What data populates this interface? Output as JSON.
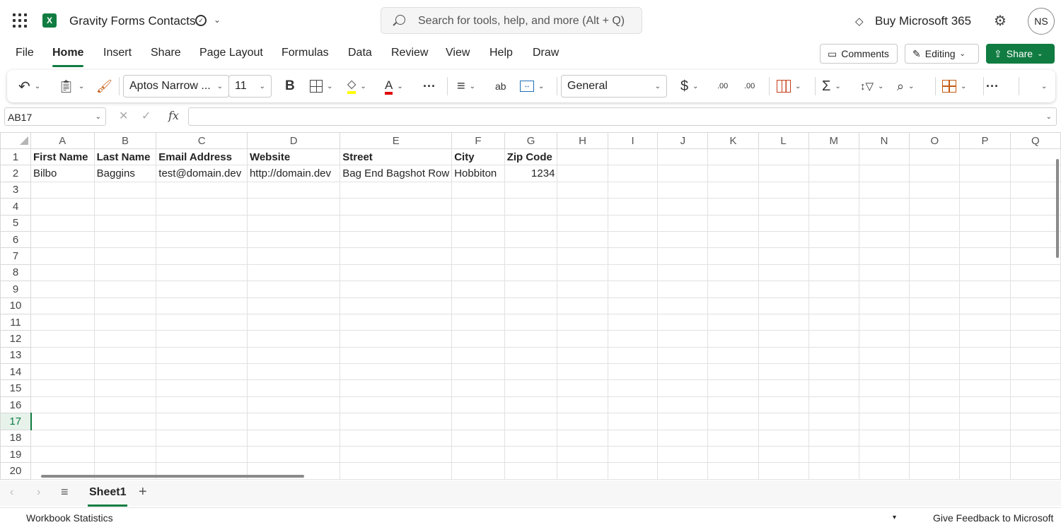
{
  "app": {
    "title": "Gravity Forms Contacts",
    "logo_letter": "X",
    "search_placeholder": "Search for tools, help, and more (Alt + Q)",
    "buy_label": "Buy Microsoft 365",
    "avatar_initials": "NS",
    "accent_color": "#107c41"
  },
  "menu": {
    "tabs": [
      "File",
      "Home",
      "Insert",
      "Share",
      "Page Layout",
      "Formulas",
      "Data",
      "Review",
      "View",
      "Help",
      "Draw"
    ],
    "active_tab": "Home",
    "comments_label": "Comments",
    "editing_label": "Editing",
    "share_label": "Share"
  },
  "ribbon": {
    "font_name": "Aptos Narrow ...",
    "font_size": "11",
    "bold_label": "B",
    "font_color_label": "A",
    "wrap_label": "ab",
    "number_format": "General",
    "currency_label": "$",
    "decrease_decimal_label": ".00",
    "increase_decimal_label": ".00",
    "more_label": "···",
    "sum_label": "Σ"
  },
  "formula_bar": {
    "name_box": "AB17",
    "fx_label": "fx",
    "cancel_label": "✕",
    "enter_label": "✓",
    "formula": ""
  },
  "sheet": {
    "columns": [
      "A",
      "B",
      "C",
      "D",
      "E",
      "F",
      "G",
      "H",
      "I",
      "J",
      "K",
      "L",
      "M",
      "N",
      "O",
      "P",
      "Q"
    ],
    "row_numbers": [
      "1",
      "2",
      "3",
      "4",
      "5",
      "6",
      "7",
      "8",
      "9",
      "10",
      "11",
      "12",
      "13",
      "14",
      "15",
      "16",
      "17",
      "18",
      "19",
      "20"
    ],
    "selected_row": "17",
    "rows": [
      [
        "First Name",
        "Last Name",
        "Email Address",
        "Website",
        "Street",
        "City",
        "Zip Code"
      ],
      [
        "Bilbo",
        "Baggins",
        "test@domain.dev",
        "http://domain.dev",
        "Bag End Bagshot Row",
        "Hobbiton",
        "1234"
      ]
    ]
  },
  "sheet_tabs": {
    "active": "Sheet1",
    "add_label": "+"
  },
  "status_bar": {
    "left": "Workbook Statistics",
    "feedback": "Give Feedback to Microsoft"
  }
}
